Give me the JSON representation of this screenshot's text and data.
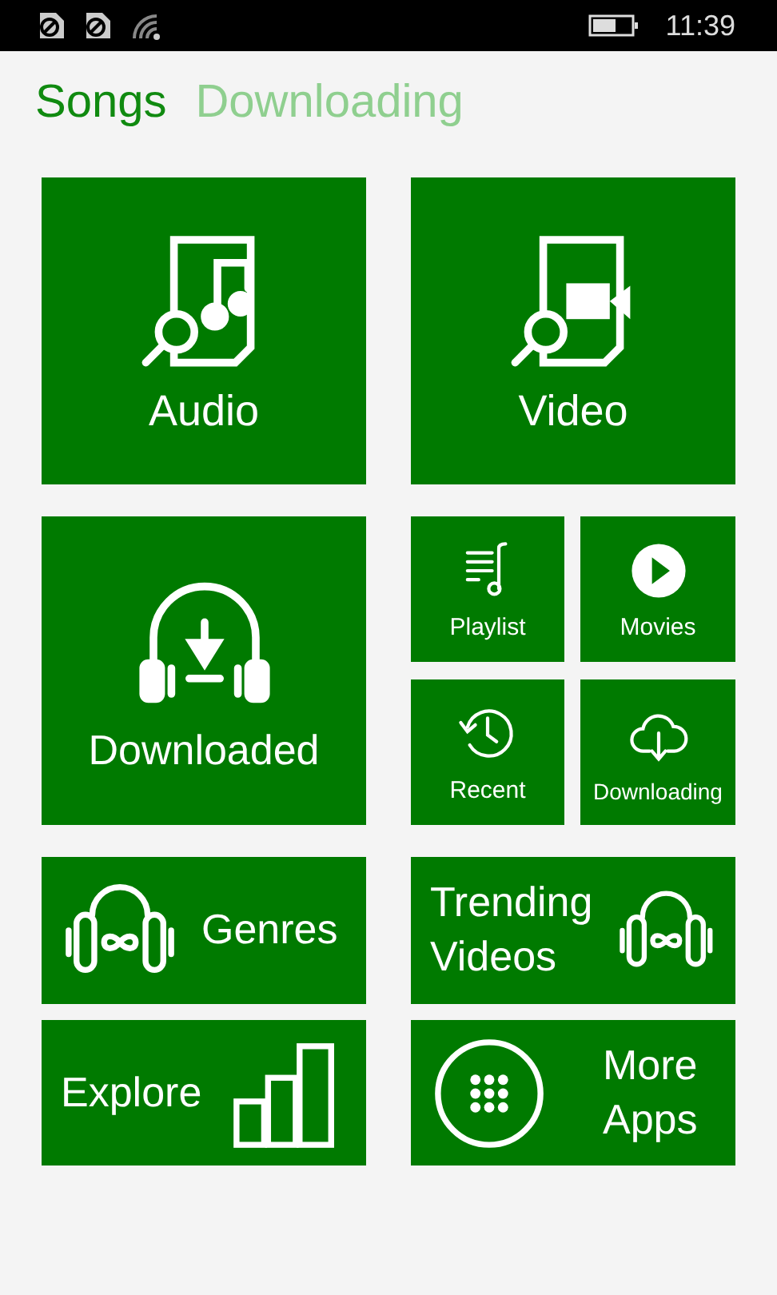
{
  "status_bar": {
    "time": "11:39"
  },
  "tabs": [
    {
      "label": "Songs",
      "selected": true
    },
    {
      "label": "Downloading",
      "selected": false
    }
  ],
  "tiles": [
    {
      "label": "Audio",
      "kind": "large"
    },
    {
      "label": "Video",
      "kind": "large"
    },
    {
      "label": "Downloaded",
      "kind": "large"
    },
    {
      "label": "Playlist",
      "kind": "small"
    },
    {
      "label": "Movies",
      "kind": "small"
    },
    {
      "label": "Recent",
      "kind": "small"
    },
    {
      "label": "Downloading",
      "kind": "small"
    },
    {
      "label": "Genres",
      "kind": "iconleft"
    },
    {
      "label": "Trending Videos",
      "kind": "iconright"
    },
    {
      "label": "Explore",
      "kind": "iconright"
    },
    {
      "label": "More Apps",
      "kind": "iconleft"
    }
  ]
}
